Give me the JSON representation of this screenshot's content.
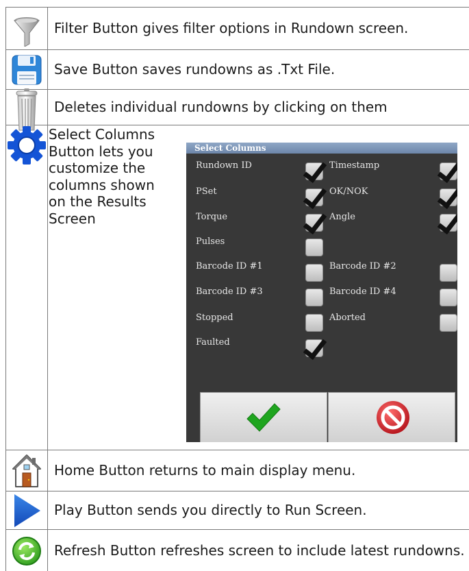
{
  "rows": {
    "filter": {
      "icon": "filter-funnel-icon",
      "text": "Filter Button gives filter options in Rundown screen."
    },
    "save": {
      "icon": "floppy-disk-icon",
      "text": "Save Button saves rundowns as .Txt File."
    },
    "delete": {
      "icon": "trash-can-icon",
      "text": "Deletes individual rundowns by clicking on them"
    },
    "select_columns": {
      "icon": "gear-icon",
      "text": "Select Columns Button lets you customize the columns shown on the Results Screen"
    },
    "home": {
      "icon": "home-icon",
      "text": "Home Button returns to main display menu."
    },
    "play": {
      "icon": "play-icon",
      "text": "Play Button sends you directly to Run Screen."
    },
    "refresh": {
      "icon": "refresh-icon",
      "text": "Refresh Button refreshes screen to include latest rundowns."
    }
  },
  "dialog": {
    "title": "Select Columns",
    "columns": [
      {
        "label": "Rundown ID",
        "checked": true
      },
      {
        "label": "Timestamp",
        "checked": true
      },
      {
        "label": "PSet",
        "checked": true
      },
      {
        "label": "OK/NOK",
        "checked": true
      },
      {
        "label": "Torque",
        "checked": true
      },
      {
        "label": "Angle",
        "checked": true
      },
      {
        "label": "Pulses",
        "checked": false
      },
      {
        "label": "Barcode ID #1",
        "checked": false
      },
      {
        "label": "Barcode ID #2",
        "checked": false
      },
      {
        "label": "Barcode ID #3",
        "checked": false
      },
      {
        "label": "Barcode ID #4",
        "checked": false
      },
      {
        "label": "Stopped",
        "checked": false
      },
      {
        "label": "Aborted",
        "checked": false
      },
      {
        "label": "Faulted",
        "checked": true
      }
    ],
    "ok_icon": "green-checkmark-icon",
    "cancel_icon": "red-no-entry-icon"
  },
  "colors": {
    "checkmark_green": "#1fa51f",
    "cancel_red": "#d8232a",
    "dialog_bg": "#383838",
    "title_bar": "#7a92b5"
  }
}
